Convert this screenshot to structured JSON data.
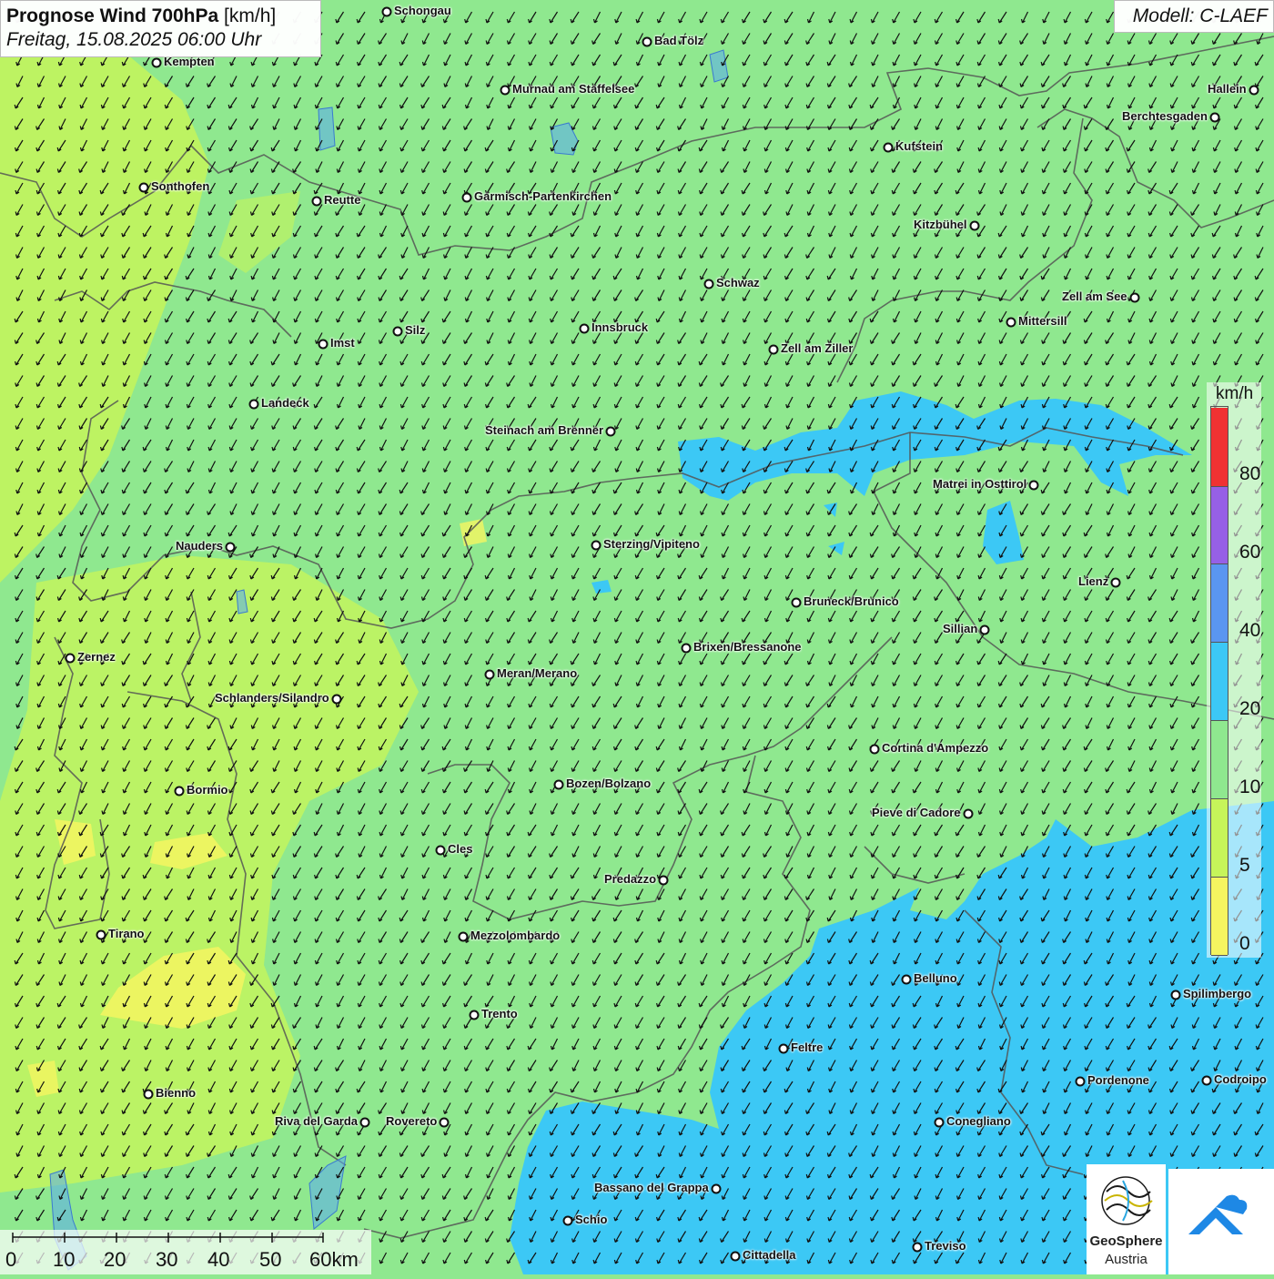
{
  "header": {
    "title": "Prognose Wind 700hPa",
    "unit": "[km/h]",
    "datetime": "Freitag, 15.08.2025 06:00 Uhr"
  },
  "model": "Modell: C-LAEF",
  "legend": {
    "unit": "km/h",
    "levels": [
      {
        "label": "0",
        "color": "#f5f560"
      },
      {
        "label": "5",
        "color": "#c6f55a"
      },
      {
        "label": "10",
        "color": "#8fe88f"
      },
      {
        "label": "20",
        "color": "#3cc8f5"
      },
      {
        "label": "40",
        "color": "#5a96f0"
      },
      {
        "label": "60",
        "color": "#9660e6"
      },
      {
        "label": "80",
        "color": "#f03232"
      }
    ]
  },
  "scale_bar": {
    "labels": [
      "0",
      "10",
      "20",
      "30",
      "40",
      "50",
      "60km"
    ]
  },
  "logo": {
    "name": "GeoSphere",
    "sub": "Austria"
  },
  "colors": {
    "light_green": "#8fe88f",
    "yellow_green": "#c6f55a",
    "yellow": "#f5f560",
    "cyan": "#3cc8f5",
    "border": "#555555",
    "arrow": "#111111"
  },
  "wind": {
    "direction": "from north-east, arrows pointing south-west"
  },
  "cities": [
    {
      "name": "Schongau",
      "side": "r"
    },
    {
      "name": "Bad Tölz",
      "side": "r"
    },
    {
      "name": "Kempten",
      "side": "r"
    },
    {
      "name": "Murnau am Staffelsee",
      "side": "r"
    },
    {
      "name": "Hallein",
      "side": "l"
    },
    {
      "name": "Berchtesgaden",
      "side": "l"
    },
    {
      "name": "Kufstein",
      "side": "r"
    },
    {
      "name": "Sonthofen",
      "side": "r"
    },
    {
      "name": "Reutte",
      "side": "r"
    },
    {
      "name": "Garmisch-Partenkirchen",
      "side": "r"
    },
    {
      "name": "Kitzbühel",
      "side": "l"
    },
    {
      "name": "Schwaz",
      "side": "r"
    },
    {
      "name": "Zell am See",
      "side": "l"
    },
    {
      "name": "Mittersill",
      "side": "r"
    },
    {
      "name": "Innsbruck",
      "side": "r"
    },
    {
      "name": "Silz",
      "side": "r"
    },
    {
      "name": "Imst",
      "side": "r"
    },
    {
      "name": "Zell am Ziller",
      "side": "r"
    },
    {
      "name": "Landeck",
      "side": "r"
    },
    {
      "name": "Steinach am Brenner",
      "side": "l"
    },
    {
      "name": "Matrei in Osttirol",
      "side": "l"
    },
    {
      "name": "Nauders",
      "side": "l"
    },
    {
      "name": "Sterzing/Vipiteno",
      "side": "r"
    },
    {
      "name": "Lienz",
      "side": "l"
    },
    {
      "name": "Bruneck/Brunico",
      "side": "r"
    },
    {
      "name": "Sillian",
      "side": "l"
    },
    {
      "name": "Brixen/Bressanone",
      "side": "r"
    },
    {
      "name": "Zernez",
      "side": "r"
    },
    {
      "name": "Meran/Merano",
      "side": "r"
    },
    {
      "name": "Schlanders/Silandro",
      "side": "l"
    },
    {
      "name": "Cortina d'Ampezzo",
      "side": "r"
    },
    {
      "name": "Bozen/Bolzano",
      "side": "r"
    },
    {
      "name": "Bormio",
      "side": "r"
    },
    {
      "name": "Pieve di Cadore",
      "side": "l"
    },
    {
      "name": "Cles",
      "side": "r"
    },
    {
      "name": "Predazzo",
      "side": "l"
    },
    {
      "name": "Tirano",
      "side": "r"
    },
    {
      "name": "Mezzolombardo",
      "side": "r"
    },
    {
      "name": "Belluno",
      "side": "r"
    },
    {
      "name": "Spilimbergo",
      "side": "r"
    },
    {
      "name": "Trento",
      "side": "r"
    },
    {
      "name": "Feltre",
      "side": "r"
    },
    {
      "name": "Pordenone",
      "side": "r"
    },
    {
      "name": "Codroipo",
      "side": "r"
    },
    {
      "name": "Bienno",
      "side": "r"
    },
    {
      "name": "Riva del Garda",
      "side": "l"
    },
    {
      "name": "Rovereto",
      "side": "l"
    },
    {
      "name": "Conegliano",
      "side": "r"
    },
    {
      "name": "Bassano del Grappa",
      "side": "l"
    },
    {
      "name": "Schio",
      "side": "r"
    },
    {
      "name": "Treviso",
      "side": "r"
    },
    {
      "name": "Cittadella",
      "side": "r"
    }
  ]
}
